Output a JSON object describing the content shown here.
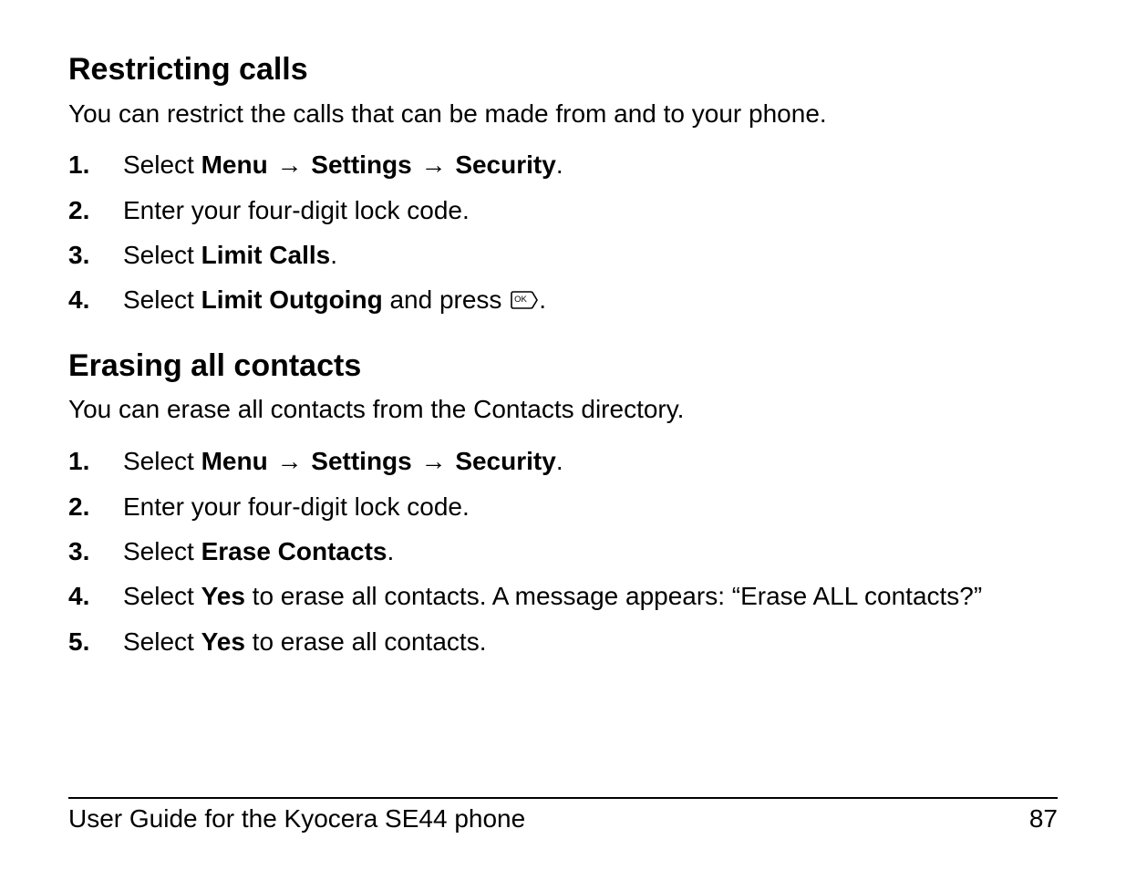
{
  "sections": [
    {
      "id": "restricting-calls",
      "heading": "Restricting calls",
      "intro": "You can restrict the calls that can be made from and to your phone.",
      "steps": [
        {
          "id": "rc-1",
          "parts": [
            {
              "t": "Select "
            },
            {
              "t": "Menu",
              "bold": true,
              "cond": true
            },
            {
              "arrow": true
            },
            {
              "t": "Settings",
              "bold": true,
              "cond": true
            },
            {
              "arrow": true
            },
            {
              "t": "Security",
              "bold": true,
              "cond": true
            },
            {
              "t": "."
            }
          ]
        },
        {
          "id": "rc-2",
          "parts": [
            {
              "t": "Enter your four-digit lock code."
            }
          ]
        },
        {
          "id": "rc-3",
          "parts": [
            {
              "t": "Select "
            },
            {
              "t": "Limit Calls",
              "bold": true,
              "cond": true
            },
            {
              "t": "."
            }
          ]
        },
        {
          "id": "rc-4",
          "parts": [
            {
              "t": "Select "
            },
            {
              "t": "Limit Outgoing",
              "bold": true,
              "cond": true
            },
            {
              "t": " and press "
            },
            {
              "ok": true
            },
            {
              "t": "."
            }
          ]
        }
      ]
    },
    {
      "id": "erasing-all-contacts",
      "heading": "Erasing all contacts",
      "intro": "You can erase all contacts from the Contacts directory.",
      "steps": [
        {
          "id": "ec-1",
          "parts": [
            {
              "t": "Select "
            },
            {
              "t": "Menu",
              "bold": true,
              "cond": true
            },
            {
              "arrow": true
            },
            {
              "t": "Settings",
              "bold": true,
              "cond": true
            },
            {
              "arrow": true
            },
            {
              "t": "Security",
              "bold": true,
              "cond": true
            },
            {
              "t": "."
            }
          ]
        },
        {
          "id": "ec-2",
          "parts": [
            {
              "t": "Enter your four-digit lock code."
            }
          ]
        },
        {
          "id": "ec-3",
          "parts": [
            {
              "t": "Select "
            },
            {
              "t": "Erase Contacts",
              "bold": true,
              "cond": true
            },
            {
              "t": "."
            }
          ]
        },
        {
          "id": "ec-4",
          "parts": [
            {
              "t": "Select "
            },
            {
              "t": "Yes",
              "bold": true,
              "cond": true
            },
            {
              "t": " to erase all contacts. A message appears: “Erase ALL contacts?”"
            }
          ]
        },
        {
          "id": "ec-5",
          "parts": [
            {
              "t": "Select "
            },
            {
              "t": "Yes",
              "bold": true,
              "cond": true
            },
            {
              "t": " to erase all contacts."
            }
          ]
        }
      ]
    }
  ],
  "symbols": {
    "arrow": "→"
  },
  "footer": {
    "title": "User Guide for the Kyocera SE44 phone",
    "page_number": "87"
  }
}
